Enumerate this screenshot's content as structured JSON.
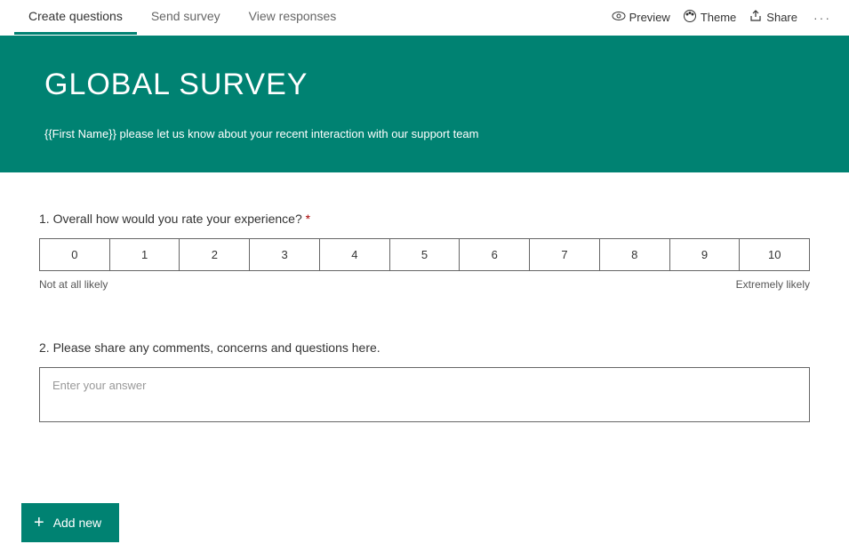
{
  "nav": {
    "tabs": [
      {
        "label": "Create questions",
        "active": true
      },
      {
        "label": "Send survey",
        "active": false
      },
      {
        "label": "View responses",
        "active": false
      }
    ],
    "actions": {
      "preview": "Preview",
      "theme": "Theme",
      "share": "Share"
    }
  },
  "hero": {
    "title": "GLOBAL SURVEY",
    "subtitle": "{{First Name}} please let us know about your recent interaction with our support team"
  },
  "questions": {
    "q1": {
      "number": "1.",
      "text": "Overall how would you rate your experience?",
      "required_marker": "*",
      "scale": [
        "0",
        "1",
        "2",
        "3",
        "4",
        "5",
        "6",
        "7",
        "8",
        "9",
        "10"
      ],
      "left_label": "Not at all likely",
      "right_label": "Extremely likely"
    },
    "q2": {
      "number": "2.",
      "text": "Please share any comments, concerns and questions here.",
      "placeholder": "Enter your answer"
    }
  },
  "add_new_label": "Add new"
}
